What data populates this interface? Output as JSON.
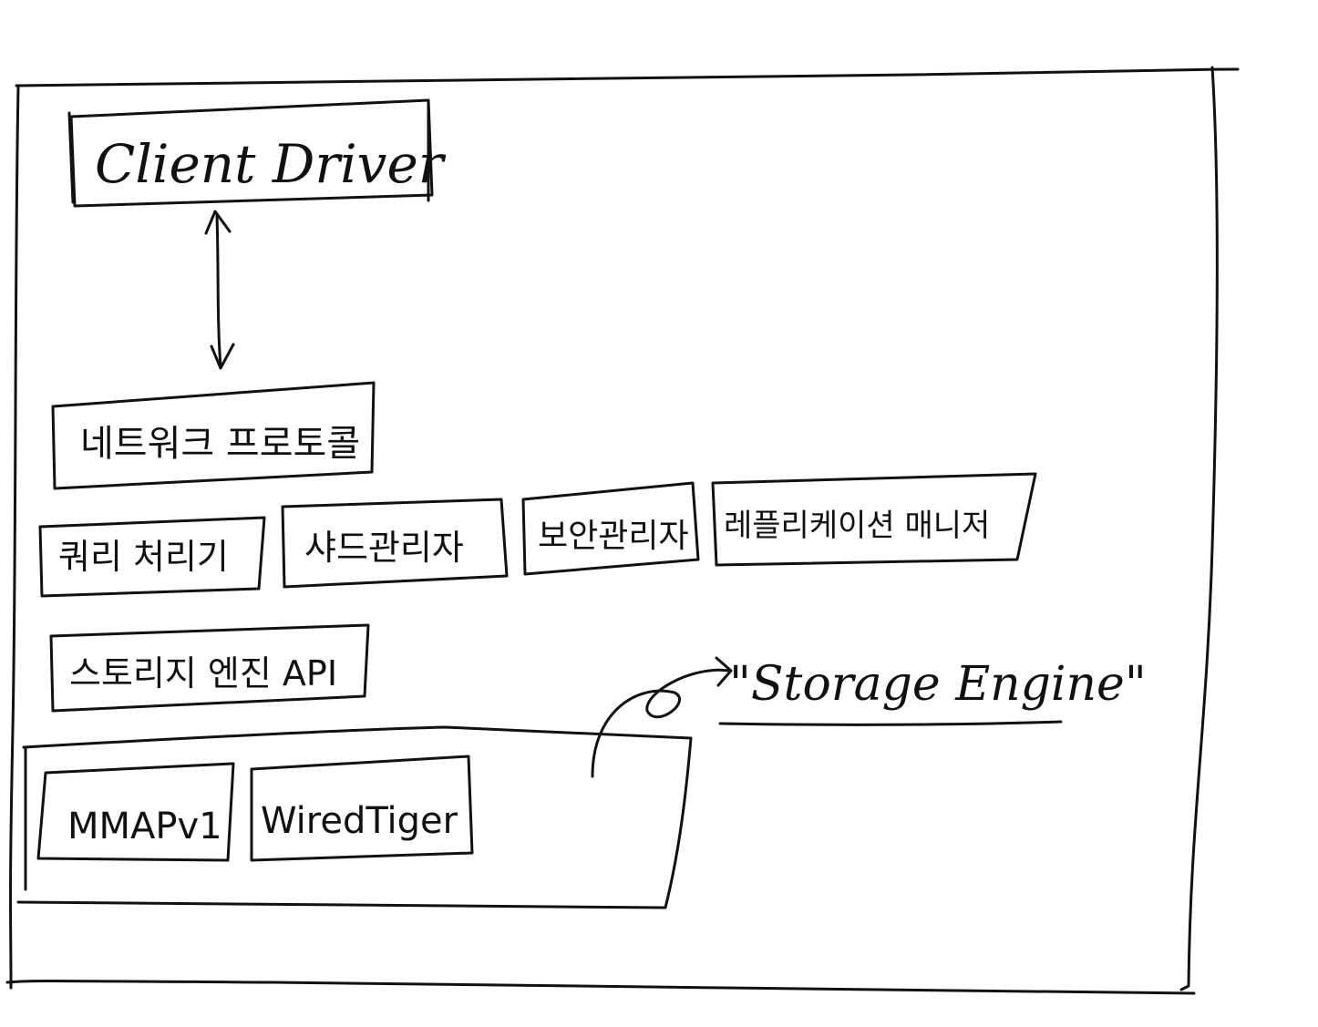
{
  "diagram": {
    "nodes": {
      "client_driver": "Client Driver",
      "network_protocol": "네트워크 프로토콜",
      "query_processor": "쿼리 처리기",
      "shard_manager": "샤드관리자",
      "security_manager": "보안관리자",
      "replication_manager": "레플리케이션 매니저",
      "storage_engine_api": "스토리지 엔진 API",
      "mmapv1": "MMAPv1",
      "wiredtiger": "WiredTiger"
    },
    "annotation": {
      "storage_engine": "\"Storage Engine\""
    },
    "edges": [
      {
        "from": "client_driver",
        "to": "network_protocol",
        "direction": "bidirectional"
      },
      {
        "from": "storage_engine_group",
        "to": "storage_engine_label",
        "direction": "forward"
      }
    ]
  }
}
